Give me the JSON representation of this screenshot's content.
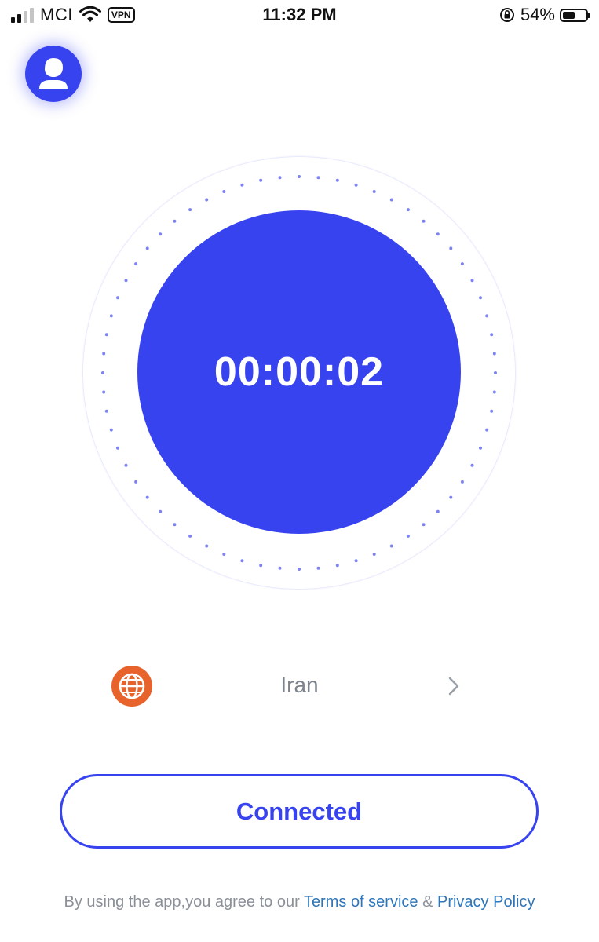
{
  "status_bar": {
    "carrier": "MCI",
    "vpn_badge": "VPN",
    "time": "11:32 PM",
    "battery_percent": "54%",
    "battery_level": 0.54,
    "signal_bars_active": 2,
    "signal_bars_total": 4
  },
  "profile": {
    "icon": "user-icon"
  },
  "connection": {
    "timer": "00:00:02",
    "status_label": "Connected",
    "accent_color": "#3843f0"
  },
  "location": {
    "name": "Iran",
    "flag_icon": "globe-icon",
    "flag_color": "#e8632b"
  },
  "legal": {
    "prefix": "By using the app,you agree to our ",
    "terms_link": "Terms of service",
    "separator": " & ",
    "privacy_link": "Privacy Policy"
  }
}
